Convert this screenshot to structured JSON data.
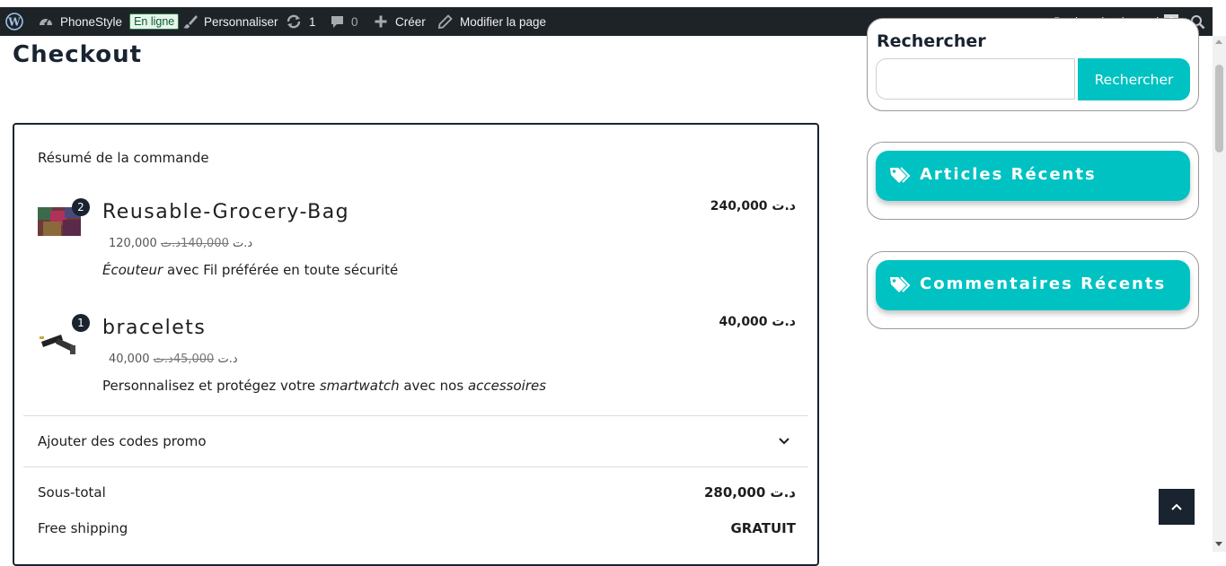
{
  "admin_bar": {
    "site_name": "PhoneStyle",
    "status_badge": "En ligne",
    "customize": "Personnaliser",
    "updates_count": "1",
    "comments_count": "0",
    "new": "Créer",
    "edit_page": "Modifier la page",
    "greeting": "Bonjour, haninermd"
  },
  "page": {
    "title": "Checkout"
  },
  "order_summary": {
    "title": "Résumé de la commande",
    "items": [
      {
        "quantity": "2",
        "name": "Reusable-Grocery-Bag",
        "regular_price": "140,000",
        "sale_price": "120,000",
        "line_total": "240,000",
        "description_italic": "Écouteur",
        "description_rest": " avec Fil préférée en toute sécurité"
      },
      {
        "quantity": "1",
        "name": "bracelets",
        "regular_price": "45,000",
        "sale_price": "40,000",
        "line_total": "40,000",
        "description_1": "Personnalisez et protégez votre ",
        "description_2": "smartwatch",
        "description_3": " avec nos ",
        "description_4": "accessoires"
      }
    ],
    "promo_label": "Ajouter des codes promo",
    "subtotal_label": "Sous-total",
    "subtotal_value": "280,000",
    "shipping_label": "Free shipping",
    "shipping_value": "GRATUIT",
    "currency_symbol": "د.ت"
  },
  "sidebar": {
    "search_heading": "Rechercher",
    "search_button": "Rechercher",
    "search_value": "",
    "recent_posts": "Articles Récents",
    "recent_comments": "Commentaires Récents"
  },
  "colors": {
    "admin_bar_bg": "#1d2327",
    "accent_teal": "#00c2c2",
    "dark_navy": "#1a2330",
    "badge_green": "#2e7d45"
  },
  "icons": [
    "wordpress-icon",
    "dashboard-icon",
    "brush-icon",
    "updates-icon",
    "comment-icon",
    "plus-icon",
    "pencil-icon",
    "avatar",
    "search-icon",
    "chevron-down-icon",
    "tag-icon",
    "arrow-up-icon"
  ]
}
